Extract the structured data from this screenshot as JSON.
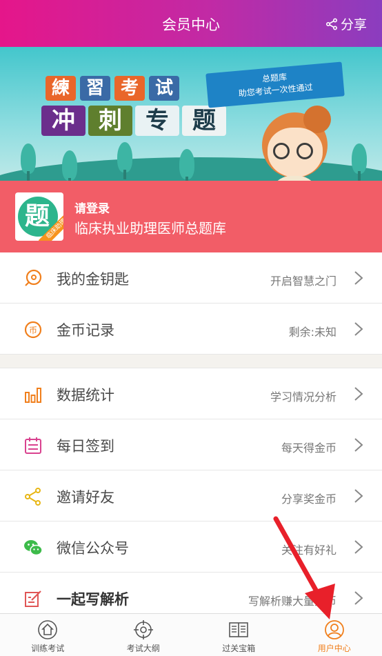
{
  "header": {
    "title": "会员中心",
    "share_label": "分享"
  },
  "banner": {
    "line1": [
      "練",
      "習",
      "考",
      "试"
    ],
    "line2": [
      "冲",
      "刺",
      "专",
      "题"
    ],
    "flag_line1": "总题库",
    "flag_line2": "助您考试一次性通过"
  },
  "login": {
    "prompt": "请登录",
    "bank_name": "临床执业助理医师总题库",
    "avatar_glyph": "题",
    "avatar_ribbon": "临床助理"
  },
  "menu": {
    "group1": [
      {
        "label": "我的金钥匙",
        "value": "开启智慧之门",
        "icon": "key-icon"
      },
      {
        "label": "金币记录",
        "value": "剩余:未知",
        "icon": "coin-icon"
      }
    ],
    "group2": [
      {
        "label": "数据统计",
        "value": "学习情况分析",
        "icon": "bar-chart-icon"
      },
      {
        "label": "每日签到",
        "value": "每天得金币",
        "icon": "calendar-icon"
      },
      {
        "label": "邀请好友",
        "value": "分享奖金币",
        "icon": "share-icon"
      },
      {
        "label": "微信公众号",
        "value": "关注有好礼",
        "icon": "wechat-icon"
      },
      {
        "label": "一起写解析",
        "value": "写解析赚大量金币",
        "icon": "edit-icon"
      }
    ]
  },
  "tabbar": {
    "items": [
      {
        "label": "训练考试",
        "icon": "home-icon"
      },
      {
        "label": "考试大纲",
        "icon": "target-icon"
      },
      {
        "label": "过关宝箱",
        "icon": "book-icon"
      },
      {
        "label": "用户中心",
        "icon": "user-icon"
      }
    ]
  },
  "colors": {
    "accent_orange": "#f07f1c",
    "login_bg": "#f25d67",
    "arrow_red": "#e8202a"
  }
}
